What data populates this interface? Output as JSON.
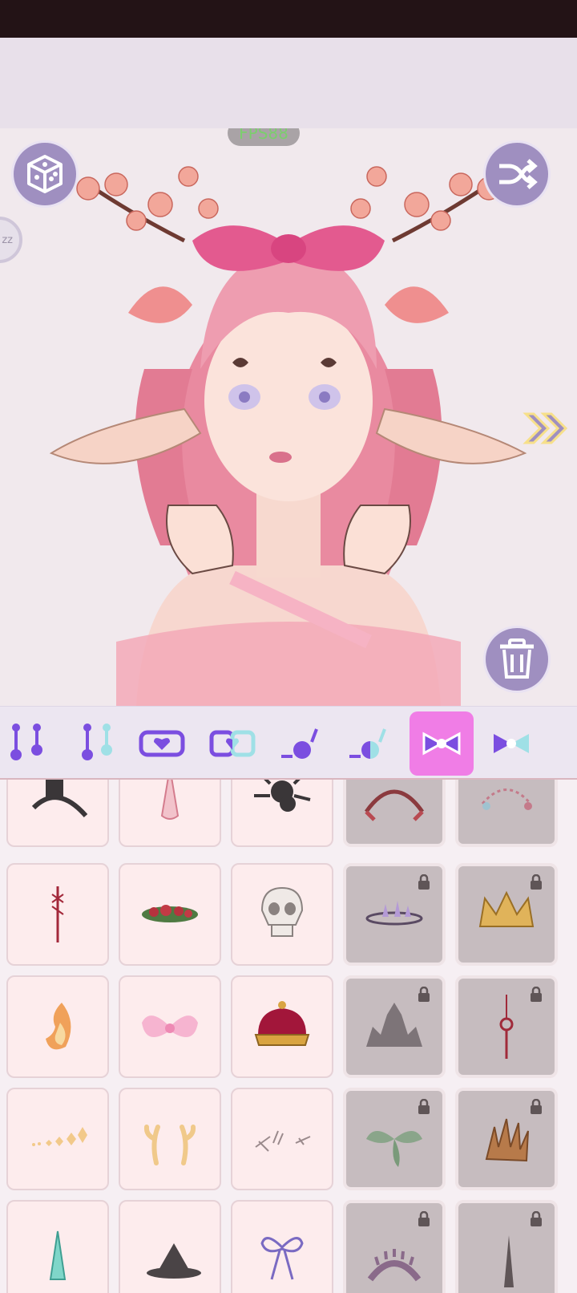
{
  "app": {
    "fps_label": "FPS88"
  },
  "colors": {
    "accent_purple": "#9f8fc0",
    "active_category": "#f07de6",
    "category_icon": "#7b4ee0"
  },
  "toolbar": {
    "randomize_icon": "dice-icon",
    "shuffle_icon": "shuffle-icon",
    "delete_icon": "trash-icon",
    "next_icon": "double-chevron-right-icon",
    "side_tab_label": "zz"
  },
  "categories": [
    {
      "name": "piercing-both",
      "active": false
    },
    {
      "name": "piercing-left",
      "active": false
    },
    {
      "name": "heart-patch",
      "active": false
    },
    {
      "name": "half-heart-patch",
      "active": false
    },
    {
      "name": "ball-piercing",
      "active": false
    },
    {
      "name": "half-ball-piercing",
      "active": false
    },
    {
      "name": "bow-front",
      "active": true
    },
    {
      "name": "bow-back",
      "active": false
    }
  ],
  "items": [
    {
      "name": "tower-headband",
      "locked": false
    },
    {
      "name": "unicorn-horn",
      "locked": false
    },
    {
      "name": "spider",
      "locked": false
    },
    {
      "name": "lace-headband",
      "locked": true
    },
    {
      "name": "ribbon-garland",
      "locked": true
    },
    {
      "name": "lace-ribbon",
      "locked": false
    },
    {
      "name": "rose-crown",
      "locked": false
    },
    {
      "name": "skull-mask",
      "locked": false
    },
    {
      "name": "crystal-tiara",
      "locked": true
    },
    {
      "name": "gold-crown",
      "locked": true
    },
    {
      "name": "flame-ornament",
      "locked": false
    },
    {
      "name": "pink-bow",
      "locked": false
    },
    {
      "name": "royal-crown",
      "locked": false
    },
    {
      "name": "spike-crown",
      "locked": true
    },
    {
      "name": "knot-charm",
      "locked": true
    },
    {
      "name": "gem-chain",
      "locked": false
    },
    {
      "name": "small-antlers",
      "locked": false
    },
    {
      "name": "scratch-marks",
      "locked": false
    },
    {
      "name": "leaf-clip",
      "locked": true
    },
    {
      "name": "thorn-crown",
      "locked": true
    },
    {
      "name": "teal-horn",
      "locked": false
    },
    {
      "name": "witch-hat",
      "locked": false
    },
    {
      "name": "lilac-bow",
      "locked": false
    },
    {
      "name": "spiked-halo",
      "locked": true
    },
    {
      "name": "dark-horn",
      "locked": true
    }
  ]
}
